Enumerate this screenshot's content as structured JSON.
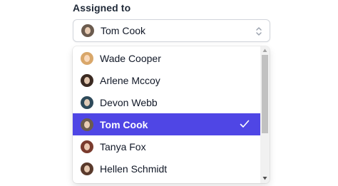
{
  "field": {
    "label": "Assigned to"
  },
  "select": {
    "selected_name": "Tom Cook",
    "selected_avatar_color": "#6b5b4e"
  },
  "options": [
    {
      "name": "Wade Cooper",
      "avatar_color": "#d9a76a",
      "icon": "avatar-wade-cooper-icon"
    },
    {
      "name": "Arlene Mccoy",
      "avatar_color": "#3b2a22",
      "icon": "avatar-arlene-mccoy-icon"
    },
    {
      "name": "Devon Webb",
      "avatar_color": "#2e4a5a",
      "icon": "avatar-devon-webb-icon"
    },
    {
      "name": "Tom Cook",
      "avatar_color": "#6b5b4e",
      "icon": "avatar-tom-cook-icon",
      "selected": true
    },
    {
      "name": "Tanya Fox",
      "avatar_color": "#7a3b2e",
      "icon": "avatar-tanya-fox-icon"
    },
    {
      "name": "Hellen Schmidt",
      "avatar_color": "#5a3a2c",
      "icon": "avatar-hellen-schmidt-icon"
    }
  ],
  "colors": {
    "selected_bg": "#4f46e5",
    "selected_text": "#ffffff",
    "border": "#d1d5db"
  }
}
